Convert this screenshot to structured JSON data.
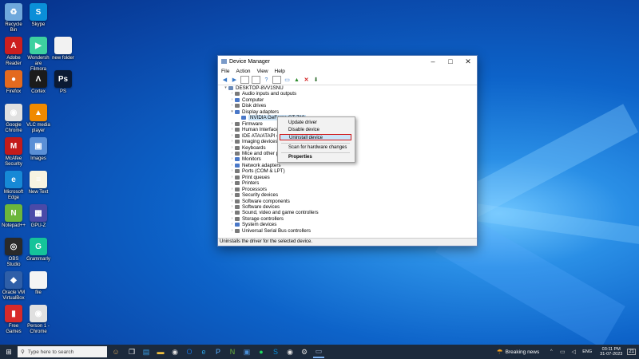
{
  "desktop_icons": [
    {
      "id": "recycle",
      "label": "Recycle Bin",
      "glyph": "♻",
      "color": "#6fa8dc"
    },
    {
      "id": "skype",
      "label": "Skype",
      "glyph": "S",
      "color": "#0a8fd8"
    },
    {
      "id": "acrobat",
      "label": "Adobe Reader",
      "glyph": "A",
      "color": "#cc1f1f"
    },
    {
      "id": "wondershare",
      "label": "Wondershare Filmora",
      "glyph": "▶",
      "color": "#3dd1a0"
    },
    {
      "id": "blank",
      "label": "new folder",
      "glyph": "",
      "color": "#f2f2f2"
    },
    {
      "id": "firefox",
      "label": "Firefox",
      "glyph": "●",
      "color": "#e46a1e"
    },
    {
      "id": "razer",
      "label": "Cortex",
      "glyph": "Λ",
      "color": "#1b1b1b"
    },
    {
      "id": "photoshop",
      "label": "PS",
      "glyph": "Ps",
      "color": "#0b1a33"
    },
    {
      "id": "chrome",
      "label": "Google Chrome",
      "glyph": "◉",
      "color": "#e0e0e0"
    },
    {
      "id": "vlc",
      "label": "VLC media player",
      "glyph": "▲",
      "color": "#f08a00"
    },
    {
      "id": "mcafee",
      "label": "McAfee Security",
      "glyph": "M",
      "color": "#c31b1b"
    },
    {
      "id": "photos",
      "label": "Images",
      "glyph": "▣",
      "color": "#5a8fd6"
    },
    {
      "id": "edge",
      "label": "Microsoft Edge",
      "glyph": "e",
      "color": "#1689d6"
    },
    {
      "id": "notepad",
      "label": "New Text",
      "glyph": "≡",
      "color": "#f7f3e1"
    },
    {
      "id": "notepadpp",
      "label": "Notepad++",
      "glyph": "N",
      "color": "#6cb63c"
    },
    {
      "id": "gpu",
      "label": "GPU-Z",
      "glyph": "▦",
      "color": "#4a4aa8"
    },
    {
      "id": "obs",
      "label": "OBS Studio",
      "glyph": "◎",
      "color": "#2a2a2a"
    },
    {
      "id": "grammarly",
      "label": "Grammarly",
      "glyph": "G",
      "color": "#15c39a"
    },
    {
      "id": "vbox",
      "label": "Oracle VM VirtualBox",
      "glyph": "◆",
      "color": "#2f5fa8"
    },
    {
      "id": "file",
      "label": "file",
      "glyph": "",
      "color": "#f4f4f4"
    },
    {
      "id": "game",
      "label": "Free Games",
      "glyph": "▮",
      "color": "#d82a2a"
    },
    {
      "id": "chrome2",
      "label": "Person 1 - Chrome",
      "glyph": "◉",
      "color": "#e0e0e0"
    }
  ],
  "window": {
    "title": "Device Manager",
    "menu": [
      "File",
      "Action",
      "View",
      "Help"
    ],
    "status": "Uninstalls the driver for the selected device."
  },
  "tree": {
    "root": "DESKTOP-8VV1SNU",
    "items": [
      {
        "label": "Audio inputs and outputs",
        "color": "#7a7a7a"
      },
      {
        "label": "Computer",
        "color": "#4a78c8"
      },
      {
        "label": "Disk drives",
        "color": "#7a7a7a"
      },
      {
        "label": "Display adapters",
        "color": "#4a78c8",
        "open": true
      },
      {
        "label": "NVIDIA GeForce GT 710",
        "color": "#4a78c8",
        "child": true,
        "selected": true
      },
      {
        "label": "Firmware",
        "color": "#7a7a7a"
      },
      {
        "label": "Human Interface Devi",
        "color": "#7a7a7a"
      },
      {
        "label": "IDE ATA/ATAPI contro",
        "color": "#7a7a7a"
      },
      {
        "label": "Imaging devices",
        "color": "#7a7a7a"
      },
      {
        "label": "Keyboards",
        "color": "#7a7a7a"
      },
      {
        "label": "Mice and other pointi",
        "color": "#7a7a7a"
      },
      {
        "label": "Monitors",
        "color": "#4a78c8"
      },
      {
        "label": "Network adapters",
        "color": "#4a78c8"
      },
      {
        "label": "Ports (COM & LPT)",
        "color": "#7a7a7a"
      },
      {
        "label": "Print queues",
        "color": "#7a7a7a"
      },
      {
        "label": "Printers",
        "color": "#7a7a7a"
      },
      {
        "label": "Processors",
        "color": "#7a7a7a"
      },
      {
        "label": "Security devices",
        "color": "#7a7a7a"
      },
      {
        "label": "Software components",
        "color": "#7a7a7a"
      },
      {
        "label": "Software devices",
        "color": "#7a7a7a"
      },
      {
        "label": "Sound, video and game controllers",
        "color": "#7a7a7a"
      },
      {
        "label": "Storage controllers",
        "color": "#7a7a7a"
      },
      {
        "label": "System devices",
        "color": "#4a78c8"
      },
      {
        "label": "Universal Serial Bus controllers",
        "color": "#7a7a7a"
      }
    ]
  },
  "context_menu": {
    "update": "Update driver",
    "disable": "Disable device",
    "uninstall": "Uninstall device",
    "scan": "Scan for hardware changes",
    "properties": "Properties"
  },
  "taskbar": {
    "search_placeholder": "Type here to search",
    "news": "Breaking news",
    "lang": "ENG",
    "time": "03:11 PM",
    "date": "31-07-2023",
    "notif_count": "21"
  }
}
